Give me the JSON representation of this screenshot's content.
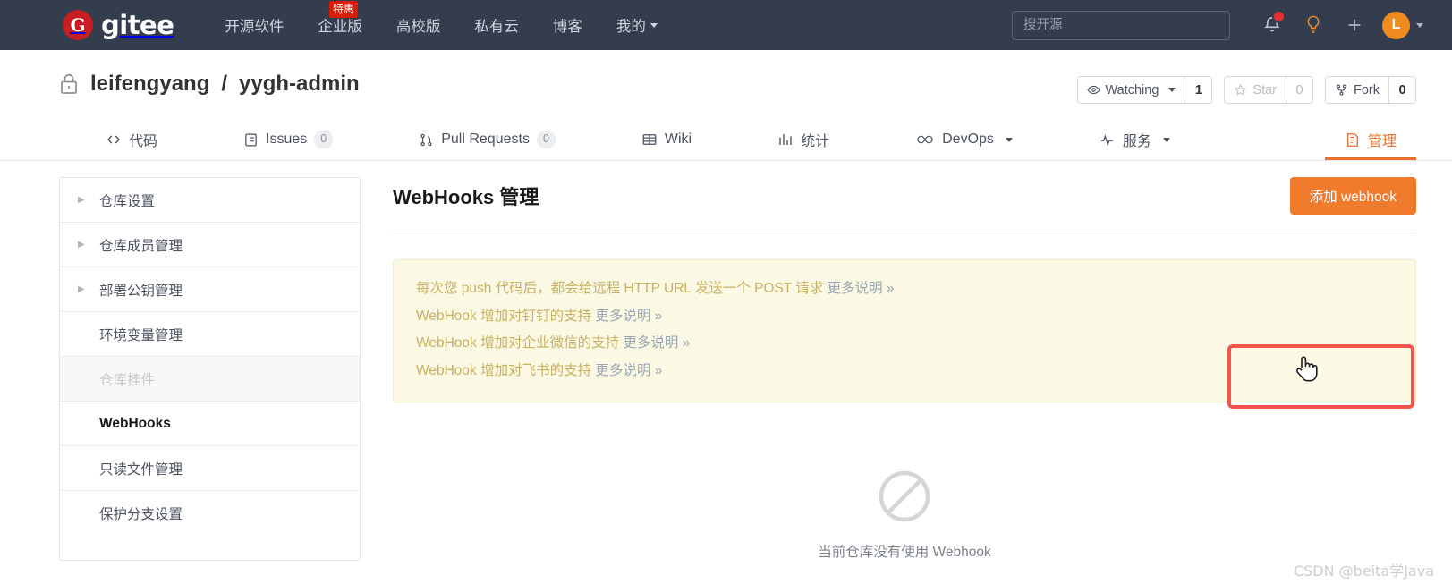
{
  "header": {
    "brand": {
      "logo_letter": "G",
      "name": "gitee"
    },
    "nav": [
      {
        "label": "开源软件",
        "badge": null,
        "caret": false
      },
      {
        "label": "企业版",
        "badge": "特惠",
        "caret": false
      },
      {
        "label": "高校版",
        "badge": null,
        "caret": false
      },
      {
        "label": "私有云",
        "badge": null,
        "caret": false
      },
      {
        "label": "博客",
        "badge": null,
        "caret": false
      },
      {
        "label": "我的",
        "badge": null,
        "caret": true
      }
    ],
    "search": {
      "placeholder": "搜开源",
      "value": ""
    },
    "icons": [
      {
        "name": "notifications-bell-icon",
        "has_badge": true
      },
      {
        "name": "lightbulb-icon",
        "has_badge": false
      },
      {
        "name": "plus-icon",
        "has_badge": false
      }
    ],
    "avatar_letter": "L"
  },
  "repo": {
    "owner": "leifengyang",
    "separator": "/",
    "name": "yygh-admin",
    "full_title": "leifengyang / yygh-admin",
    "visibility_icon": "lock-icon",
    "actions": [
      {
        "label": "Watching",
        "count": "1",
        "has_caret": true,
        "muted": false
      },
      {
        "label": "Star",
        "count": "0",
        "has_caret": false,
        "muted": true
      },
      {
        "label": "Fork",
        "count": "0",
        "has_caret": false,
        "muted": false
      }
    ]
  },
  "tabs": [
    {
      "label": "代码",
      "icon": "code-icon",
      "count": null,
      "caret": false,
      "active": false
    },
    {
      "label": "Issues",
      "icon": "issue-icon",
      "count": "0",
      "caret": false,
      "active": false
    },
    {
      "label": "Pull Requests",
      "icon": "pull-request-icon",
      "count": "0",
      "caret": false,
      "active": false
    },
    {
      "label": "Wiki",
      "icon": "book-icon",
      "count": null,
      "caret": false,
      "active": false
    },
    {
      "label": "统计",
      "icon": "chart-icon",
      "count": null,
      "caret": false,
      "active": false
    },
    {
      "label": "DevOps",
      "icon": "infinity-icon",
      "count": null,
      "caret": true,
      "active": false
    },
    {
      "label": "服务",
      "icon": "pulse-icon",
      "count": null,
      "caret": true,
      "active": false
    },
    {
      "label": "管理",
      "icon": "settings-doc-icon",
      "count": null,
      "caret": false,
      "active": true
    }
  ],
  "sidebar": {
    "items": [
      {
        "label": "仓库设置",
        "expandable": true,
        "active": false,
        "disabled": false
      },
      {
        "label": "仓库成员管理",
        "expandable": true,
        "active": false,
        "disabled": false
      },
      {
        "label": "部署公钥管理",
        "expandable": true,
        "active": false,
        "disabled": false
      },
      {
        "label": "环境变量管理",
        "expandable": false,
        "active": false,
        "disabled": false
      },
      {
        "label": "仓库挂件",
        "expandable": false,
        "active": false,
        "disabled": true
      },
      {
        "label": "WebHooks",
        "expandable": false,
        "active": true,
        "disabled": false
      },
      {
        "label": "只读文件管理",
        "expandable": false,
        "active": false,
        "disabled": false
      },
      {
        "label": "保护分支设置",
        "expandable": false,
        "active": false,
        "disabled": false
      }
    ]
  },
  "main": {
    "page_title": "WebHooks 管理",
    "add_button_label": "添加 webhook",
    "notice_lines": [
      {
        "text": "每次您 push 代码后，都会给远程 HTTP URL 发送一个 POST 请求 ",
        "link": "更多说明 »"
      },
      {
        "text": "WebHook 增加对钉钉的支持 ",
        "link": "更多说明 »"
      },
      {
        "text": "WebHook 增加对企业微信的支持 ",
        "link": "更多说明 »"
      },
      {
        "text": "WebHook 增加对飞书的支持 ",
        "link": "更多说明 »"
      }
    ],
    "empty_state": {
      "icon": "no-entry-icon",
      "text": "当前仓库没有使用 Webhook"
    }
  },
  "annotation": {
    "highlight_color": "#f4554a",
    "cursor": "hand-pointer-cursor"
  },
  "watermark": "CSDN @beita学Java",
  "colors": {
    "header_bg": "#333d4d",
    "brand_red": "#c71d23",
    "accent_orange": "#e8702a",
    "button_orange": "#f07b2d",
    "notice_bg": "#fbf8e3",
    "notice_border": "#ecebcb",
    "notice_text": "#c9b163",
    "annotation_red": "#f4554a"
  }
}
